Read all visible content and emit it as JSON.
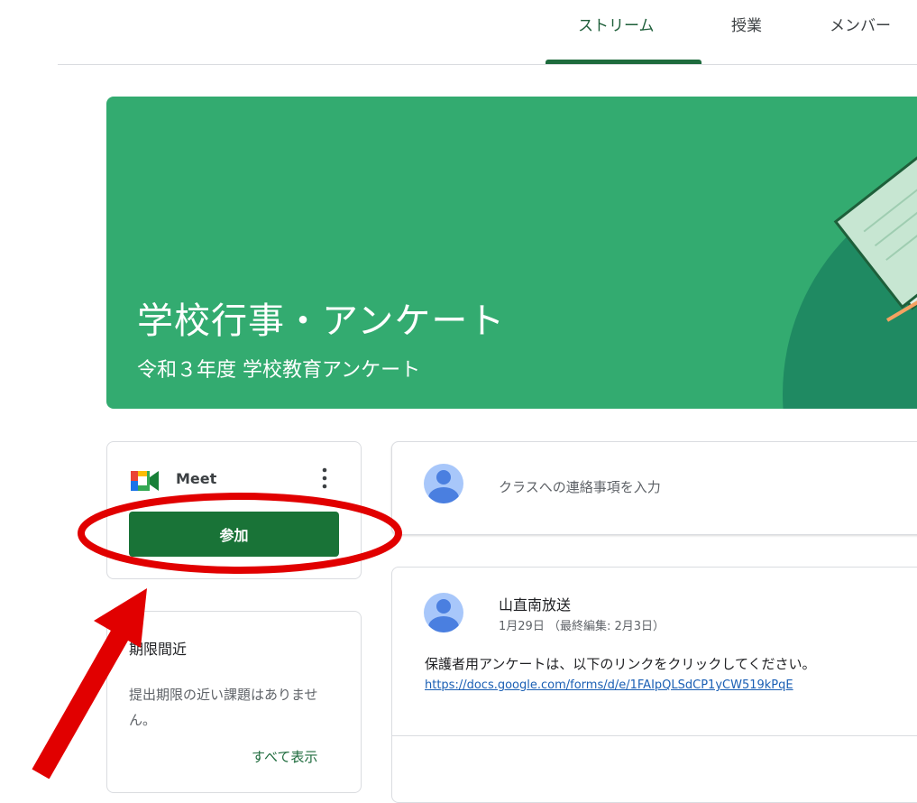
{
  "nav": {
    "tabs": [
      {
        "label": "ストリーム"
      },
      {
        "label": "授業"
      },
      {
        "label": "メンバー"
      }
    ]
  },
  "banner": {
    "title": "学校行事・アンケート",
    "subtitle": "令和３年度 学校教育アンケート"
  },
  "meet": {
    "label": "Meet",
    "join_label": "参加"
  },
  "upcoming": {
    "title": "期限間近",
    "empty_text": "提出期限の近い課題はありません。",
    "view_all": "すべて表示"
  },
  "announce": {
    "placeholder": "クラスへの連絡事項を入力"
  },
  "post": {
    "author": "山直南放送",
    "date": "1月29日 （最終編集: 2月3日）",
    "body": "保護者用アンケートは、以下のリンクをクリックしてください。",
    "link": "https://docs.google.com/forms/d/e/1FAIpQLSdCP1yCW519kPqE"
  },
  "colors": {
    "accent": "#1e6b3d",
    "banner": "#33ab70",
    "join_button": "#197337",
    "annotation": "#e10000"
  }
}
